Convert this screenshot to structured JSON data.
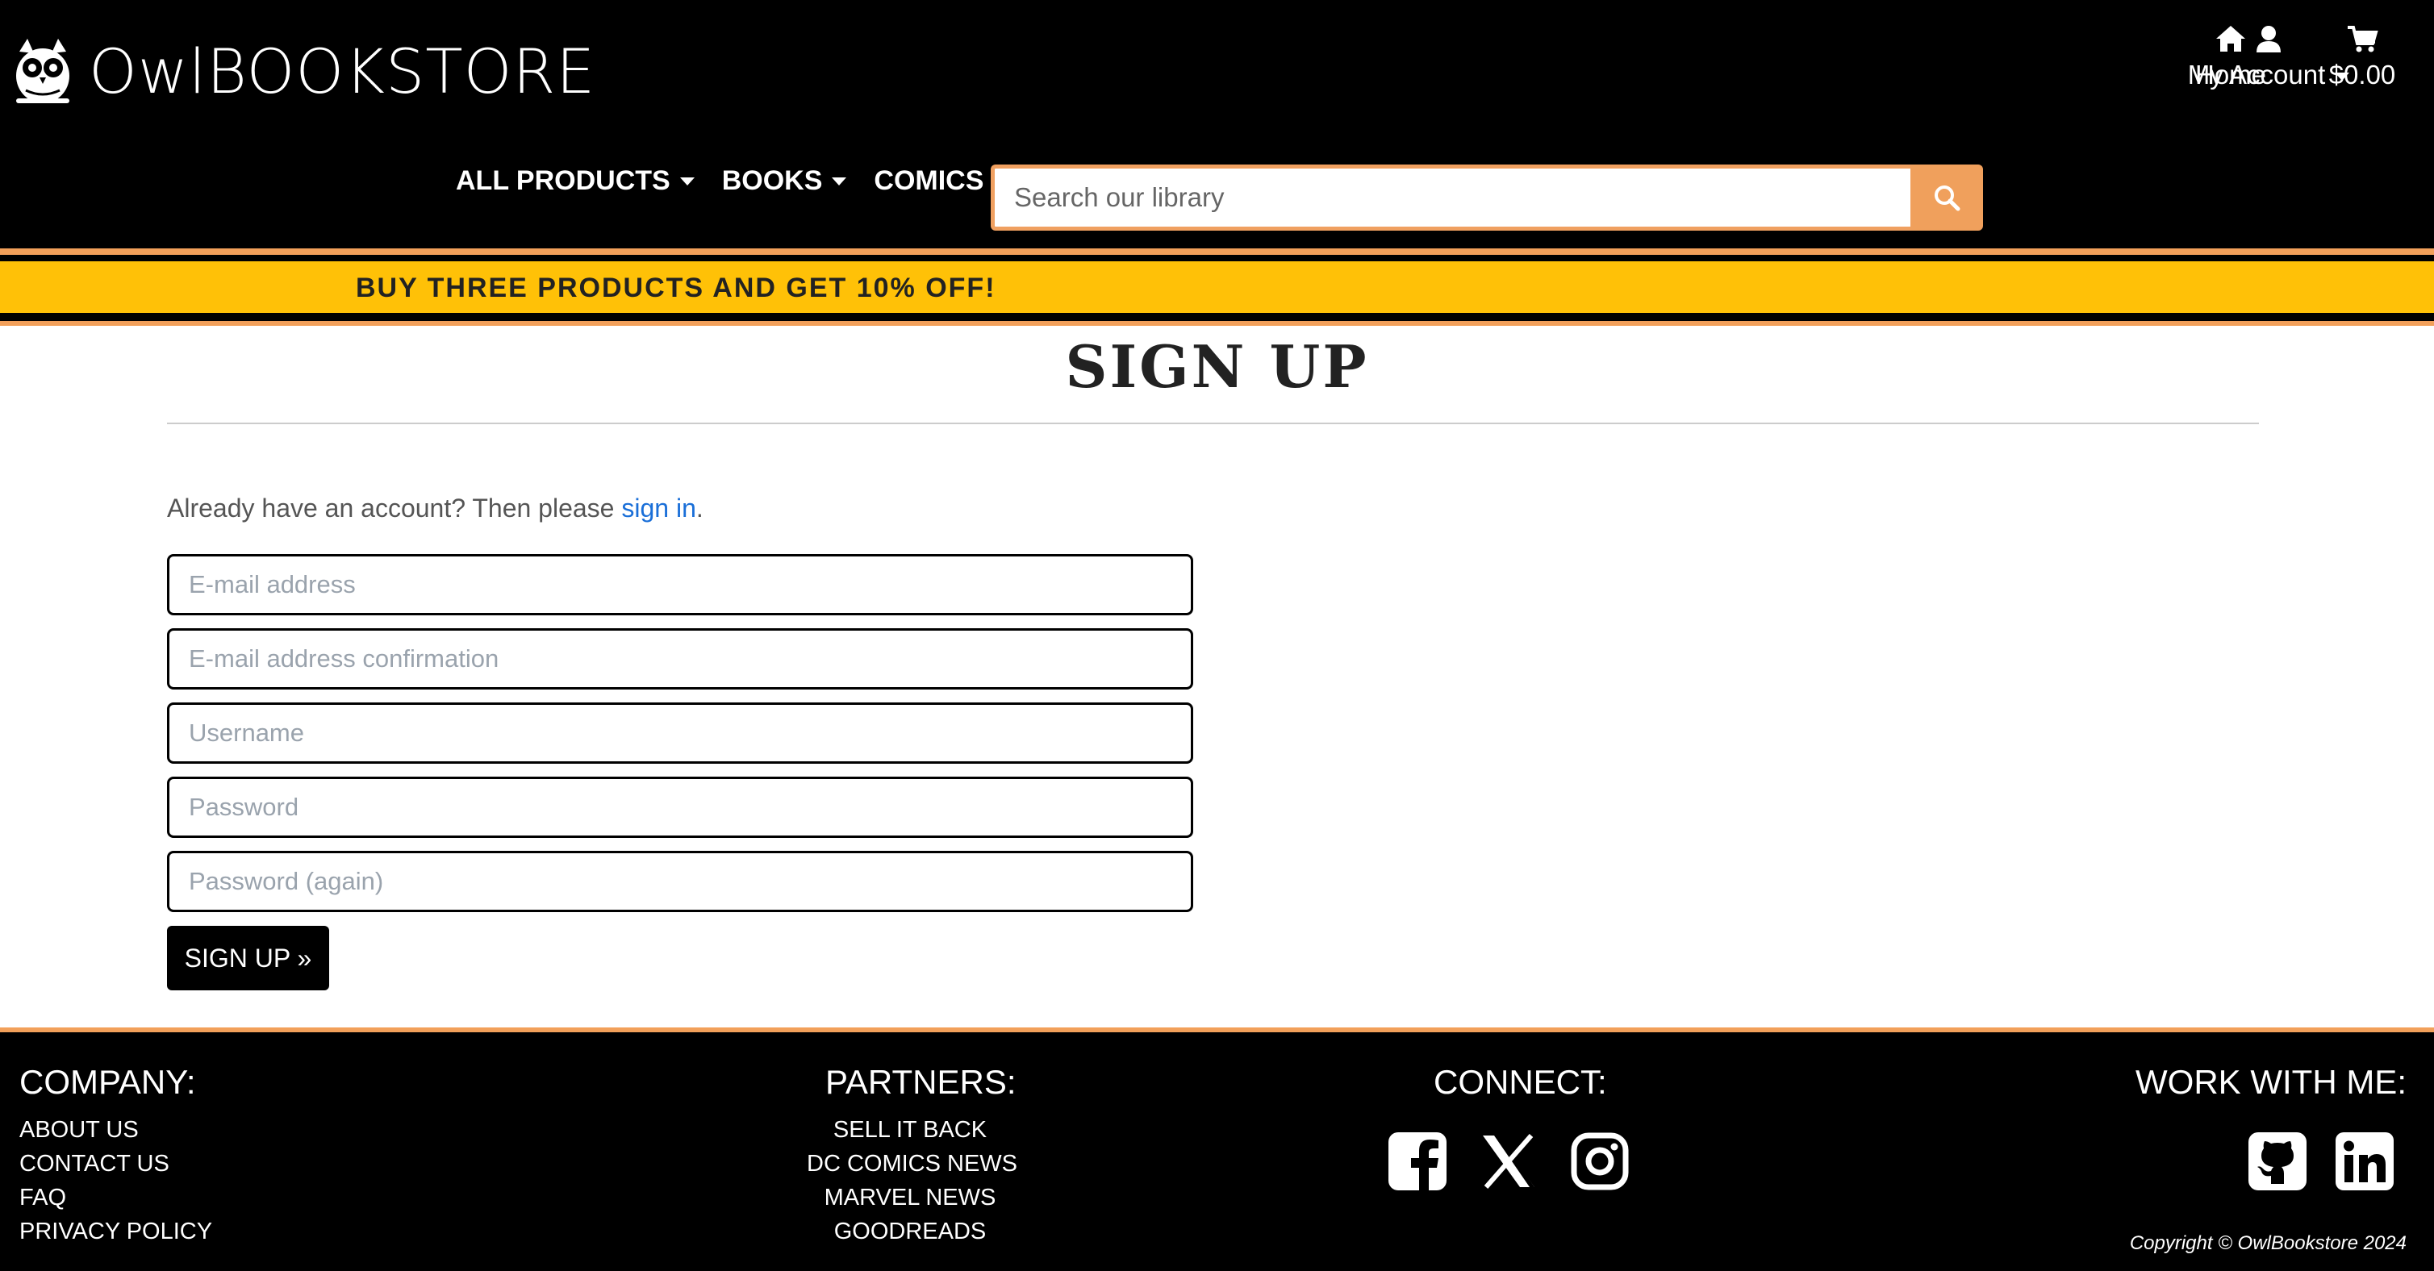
{
  "header": {
    "logo": {
      "text": "OwlBOOKSTORE",
      "icon": "owl-icon"
    },
    "top_nav": {
      "home": {
        "label": "Home",
        "icon": "home-icon"
      },
      "account": {
        "label": "My Account",
        "icon": "user-icon"
      },
      "cart": {
        "label": "$0.00",
        "icon": "cart-icon"
      }
    },
    "main_nav": [
      {
        "label": "ALL PRODUCTS"
      },
      {
        "label": "BOOKS"
      },
      {
        "label": "COMICS"
      }
    ],
    "search": {
      "placeholder": "Search our library",
      "button_icon": "search-icon"
    }
  },
  "promo": {
    "text": "BUY THREE PRODUCTS AND GET 10% OFF!"
  },
  "main": {
    "title": "SIGN UP",
    "signin_prefix": "Already have an account? Then please ",
    "signin_link": "sign in",
    "signin_suffix": ".",
    "fields": {
      "email": "E-mail address",
      "email_confirm": "E-mail address confirmation",
      "username": "Username",
      "password": "Password",
      "password_again": "Password (again)"
    },
    "submit_label": "SIGN UP »"
  },
  "footer": {
    "company": {
      "heading": "COMPANY:",
      "links": [
        "ABOUT US",
        "CONTACT US",
        "FAQ",
        "PRIVACY POLICY"
      ]
    },
    "partners": {
      "heading": "PARTNERS:",
      "links": [
        "SELL IT BACK",
        "DC COMICS NEWS",
        "MARVEL NEWS",
        "GOODREADS"
      ]
    },
    "connect": {
      "heading": "CONNECT:",
      "icons": [
        "facebook-icon",
        "x-icon",
        "instagram-icon"
      ]
    },
    "work": {
      "heading": "WORK WITH ME:",
      "icons": [
        "github-icon",
        "linkedin-icon"
      ]
    },
    "copyright": "Copyright © OwlBookstore 2024"
  },
  "colors": {
    "accent_orange": "#f2a05a",
    "promo_yellow": "#ffc107",
    "link_blue": "#1a6fd8"
  }
}
